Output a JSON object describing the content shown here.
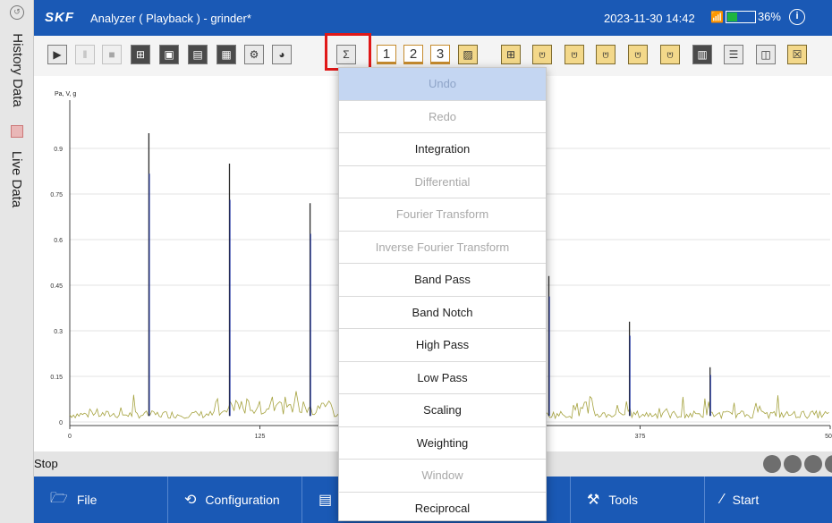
{
  "sidebar": {
    "tabs": [
      {
        "label": "History Data"
      },
      {
        "label": "Live Data"
      }
    ]
  },
  "titlebar": {
    "brand": "SKF",
    "title": "Analyzer ( Playback ) - grinder*",
    "datetime": "2023-11-30 14:42",
    "battery_text": "36%",
    "battery_level": 0.36
  },
  "toolbar": {
    "buttons": [
      {
        "name": "play-icon",
        "glyph": "▶"
      },
      {
        "name": "pause-icon",
        "glyph": "‖"
      },
      {
        "name": "stop-icon",
        "glyph": "■"
      },
      {
        "name": "add-folder-icon",
        "glyph": "⊞"
      },
      {
        "name": "open-folder-icon",
        "glyph": "▣"
      },
      {
        "name": "save-icon",
        "glyph": "▤"
      },
      {
        "name": "calculator-icon",
        "glyph": "▦"
      },
      {
        "name": "gear-icon",
        "glyph": "⚙"
      },
      {
        "name": "pie-chart-icon",
        "glyph": "◕"
      },
      {
        "name": "sigma-icon",
        "glyph": "Σ"
      },
      {
        "name": "channel-1-button",
        "glyph": "1"
      },
      {
        "name": "channel-2-button",
        "glyph": "2"
      },
      {
        "name": "channel-3-button",
        "glyph": "3"
      },
      {
        "name": "image-tool-icon",
        "glyph": "▨"
      },
      {
        "name": "cursor-add-icon",
        "glyph": "⊞"
      },
      {
        "name": "spectrum-1-icon",
        "glyph": "⩅"
      },
      {
        "name": "spectrum-2-icon",
        "glyph": "⩅"
      },
      {
        "name": "spectrum-3-icon",
        "glyph": "⩅"
      },
      {
        "name": "spectrum-4-icon",
        "glyph": "⩅"
      },
      {
        "name": "spectrum-5-icon",
        "glyph": "⩅"
      },
      {
        "name": "layout-single-icon",
        "glyph": "▥"
      },
      {
        "name": "layout-rows-icon",
        "glyph": "☰"
      },
      {
        "name": "layout-columns-icon",
        "glyph": "◫"
      },
      {
        "name": "close-panel-icon",
        "glyph": "☒"
      }
    ]
  },
  "chart_data": {
    "type": "line",
    "ylabel": "Pa, V, g",
    "yticks": [
      "0",
      "0.15",
      "0.3",
      "0.45",
      "0.6",
      "0.75",
      "0.9"
    ],
    "xticks": [
      "0",
      "125",
      "375",
      "500"
    ],
    "ylim": [
      0,
      1.0
    ],
    "xlim": [
      0,
      500
    ],
    "grid": true,
    "peaks_x": [
      52,
      105,
      158,
      315,
      368,
      421
    ],
    "peaks_y": [
      0.95,
      0.85,
      0.72,
      0.48,
      0.33,
      0.18
    ],
    "colors": {
      "dark": "#2b2b2b",
      "blue": "#1a2fa0",
      "olive": "#a5a23e"
    }
  },
  "statusbar": {
    "text": "Stop"
  },
  "bottomnav": {
    "items": [
      {
        "label": "File",
        "icon": "folder-icon"
      },
      {
        "label": "Configuration",
        "icon": "configuration-icon"
      },
      {
        "label": "",
        "icon": "monitor-icon"
      },
      {
        "label": "Tools",
        "icon": "tools-icon"
      },
      {
        "label": "Start",
        "icon": "start-icon"
      }
    ]
  },
  "menu": {
    "items": [
      {
        "label": "Undo",
        "state": "selected"
      },
      {
        "label": "Redo",
        "state": "disabled"
      },
      {
        "label": "Integration",
        "state": "enabled"
      },
      {
        "label": "Differential",
        "state": "disabled"
      },
      {
        "label": "Fourier Transform",
        "state": "disabled"
      },
      {
        "label": "Inverse Fourier Transform",
        "state": "disabled"
      },
      {
        "label": "Band Pass",
        "state": "enabled"
      },
      {
        "label": "Band Notch",
        "state": "enabled"
      },
      {
        "label": "High Pass",
        "state": "enabled"
      },
      {
        "label": "Low Pass",
        "state": "enabled"
      },
      {
        "label": "Scaling",
        "state": "enabled"
      },
      {
        "label": "Weighting",
        "state": "enabled"
      },
      {
        "label": "Window",
        "state": "disabled"
      },
      {
        "label": "Reciprocal",
        "state": "enabled"
      }
    ]
  }
}
